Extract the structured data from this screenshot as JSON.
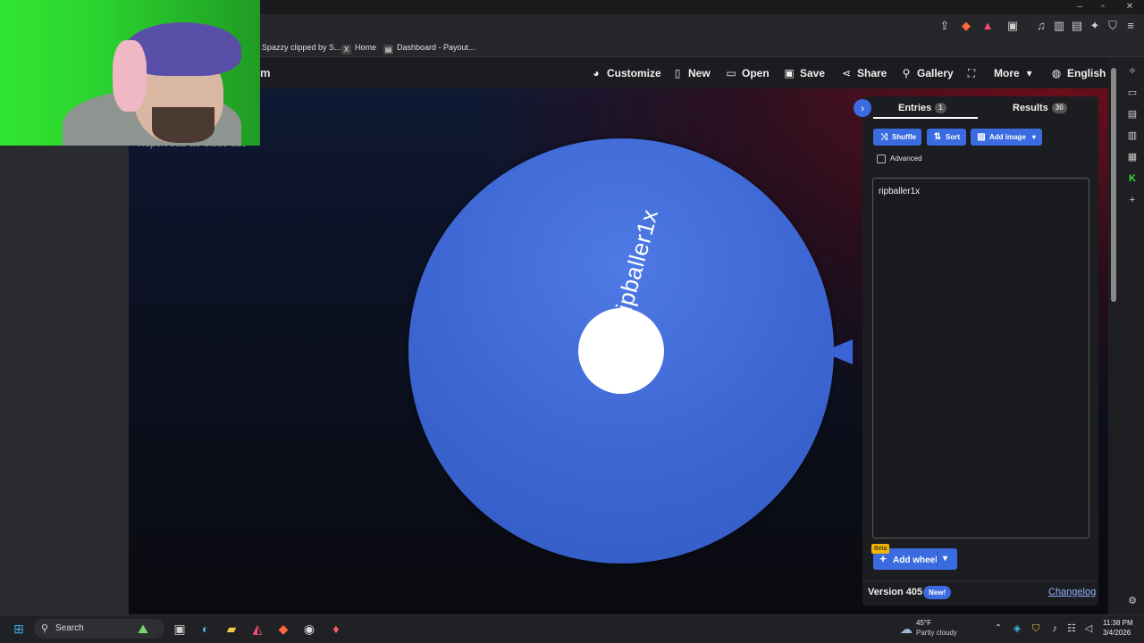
{
  "browser": {
    "bookmarks": [
      {
        "label": "Spazzy clipped by S...",
        "icon": "clip-icon"
      },
      {
        "label": "Home",
        "icon": "x-logo-icon"
      },
      {
        "label": "Dashboard - Payout...",
        "icon": "dashboard-icon"
      }
    ]
  },
  "site": {
    "logo_fragment": "m",
    "ad_text": "Report bad ad   Close ads",
    "nav": {
      "customize": "Customize",
      "new": "New",
      "open": "Open",
      "save": "Save",
      "share": "Share",
      "gallery": "Gallery",
      "more": "More",
      "language": "English"
    }
  },
  "wheel": {
    "color": "#3e67d3",
    "label": "ripballer1x"
  },
  "panel": {
    "collapse_icon": "›",
    "tabs": [
      {
        "label": "Entries",
        "count": "1"
      },
      {
        "label": "Results",
        "count": "30"
      }
    ],
    "buttons": {
      "shuffle": "Shuffle",
      "sort": "Sort",
      "add_image": "Add image"
    },
    "advanced_label": "Advanced",
    "entries_text": "ripballer1x",
    "beta_badge": "Beta",
    "add_wheel": "Add wheel",
    "version": "Version 405",
    "new_badge": "New!",
    "changelog": "Changelog"
  },
  "taskbar": {
    "search_placeholder": "Search",
    "weather_temp": "45°F",
    "weather_desc": "Partly cloudy",
    "time": "11:38 PM",
    "date": "3/4/2026"
  }
}
